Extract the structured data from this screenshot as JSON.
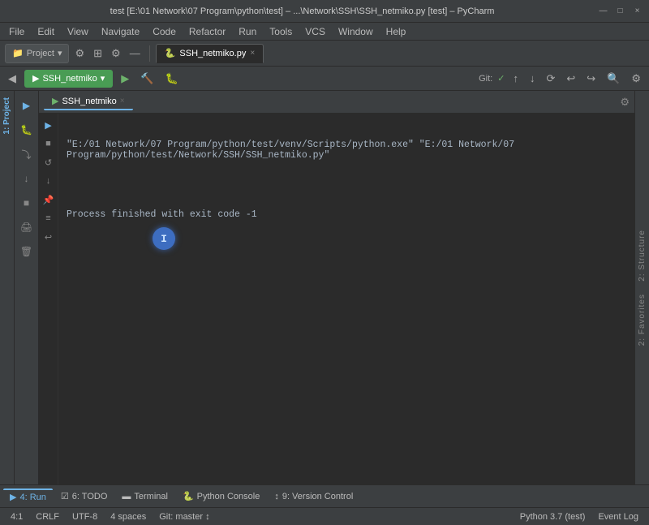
{
  "titleBar": {
    "title": "test [E:\\01 Network\\07 Program\\python\\test] – ...\\Network\\SSH\\SSH_netmiko.py [test] – PyCharm",
    "controls": [
      "—",
      "□",
      "×"
    ]
  },
  "menuBar": {
    "items": [
      "File",
      "Edit",
      "View",
      "Navigate",
      "Code",
      "Refactor",
      "Run",
      "Tools",
      "VCS",
      "Window",
      "Help"
    ]
  },
  "toolbar1": {
    "projectLabel": "Project",
    "tabs": [
      {
        "label": "SSH_netmiko.py",
        "active": true
      }
    ]
  },
  "runToolbar": {
    "configName": "SSH_netmiko",
    "gitLabel": "Git:",
    "gitBranch": "master",
    "gitCheck": "✓"
  },
  "projectPanel": {
    "label": "1: Project"
  },
  "runPanel": {
    "tabLabel": "Run",
    "tabName": "SSH_netmiko",
    "tabClose": "×",
    "settingsIcon": "⚙"
  },
  "terminal": {
    "cmdLine": "\"E:/01 Network/07 Program/python/test/venv/Scripts/python.exe\" \"E:/01 Network/07 Program/python/test/Network/SSH/SSH_netmiko.py\"",
    "exitLine": "Process finished with exit code -1"
  },
  "sideButtons": {
    "play": "▶",
    "stop": "■",
    "rerun": "↺",
    "scrollDown": "↓",
    "pin": "📌",
    "filter": "≡",
    "wrap": "↩"
  },
  "rightTabs": {
    "structure": "2: Structure",
    "favorites": "2: Favorites"
  },
  "bottomToolbar": {
    "items": [
      {
        "label": "4: Run",
        "icon": "▶",
        "active": true
      },
      {
        "label": "6: TODO",
        "icon": "☑"
      },
      {
        "label": "Terminal",
        "icon": "▬"
      },
      {
        "label": "Python Console",
        "icon": "🐍"
      },
      {
        "label": "9: Version Control",
        "icon": "↕"
      }
    ]
  },
  "statusBar": {
    "position": "4:1",
    "lineEnding": "CRLF",
    "encoding": "UTF-8",
    "indent": "4 spaces",
    "git": "Git: master ↕",
    "python": "Python 3.7 (test)",
    "eventLog": "Event Log"
  },
  "cursorChar": "I"
}
